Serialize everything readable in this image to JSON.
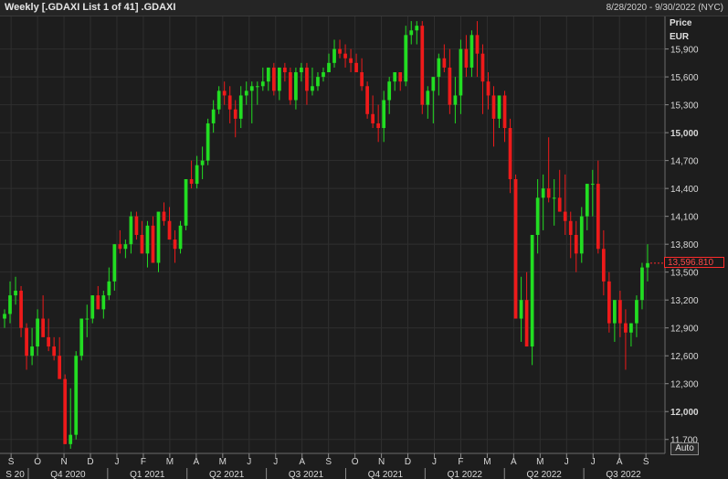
{
  "header": {
    "title": "Weekly [.GDAXI List 1 of 41] .GDAXI",
    "date_range": "8/28/2020 - 9/30/2022 (NYC)"
  },
  "axis": {
    "price_label": "Price",
    "currency_label": "EUR",
    "auto_label": "Auto"
  },
  "last_price_label": "13,596.810",
  "colors": {
    "up": "#22dd22",
    "down": "#ee1a1a",
    "background": "#1d1d1d",
    "grid": "#2f2f2f",
    "last_price": "#ff2a2a"
  },
  "chart_data": {
    "type": "candlestick",
    "title": "Weekly [.GDAXI List 1 of 41] .GDAXI",
    "ylabel": "Price EUR",
    "ylim": [
      11550,
      16250
    ],
    "y_ticks": [
      11700,
      12000,
      12300,
      12600,
      12900,
      13200,
      13500,
      13800,
      14100,
      14400,
      14700,
      15000,
      15300,
      15600,
      15900
    ],
    "y_tick_labels": [
      "11,700",
      "12,000",
      "12,300",
      "12,600",
      "12,900",
      "13,200",
      "13,500",
      "13,800",
      "14,100",
      "14,400",
      "14,700",
      "15,000",
      "15,300",
      "15,600",
      "15,900"
    ],
    "bold_ticks": [
      12000,
      15000
    ],
    "month_labels": [
      "S",
      "O",
      "N",
      "D",
      "J",
      "F",
      "M",
      "A",
      "M",
      "J",
      "J",
      "A",
      "S",
      "O",
      "N",
      "D",
      "J",
      "F",
      "M",
      "A",
      "M",
      "J",
      "J",
      "A",
      "S"
    ],
    "quarter_labels": [
      "S 20",
      "Q4 2020",
      "Q1 2021",
      "Q2 2021",
      "Q3 2021",
      "Q4 2021",
      "Q1 2022",
      "Q2 2022",
      "Q3 2022"
    ],
    "grid": true,
    "last_price": 13596.81,
    "ohlc": [
      [
        13000,
        13100,
        12900,
        13050
      ],
      [
        13050,
        13400,
        12950,
        13250
      ],
      [
        13250,
        13450,
        13150,
        13300
      ],
      [
        13300,
        13350,
        12800,
        12900
      ],
      [
        12900,
        12950,
        12450,
        12600
      ],
      [
        12600,
        12900,
        12500,
        12700
      ],
      [
        12700,
        13100,
        12600,
        13000
      ],
      [
        13000,
        13250,
        12850,
        12800
      ],
      [
        12800,
        13000,
        12650,
        12700
      ],
      [
        12700,
        12800,
        12550,
        12600
      ],
      [
        12600,
        12800,
        12400,
        12350
      ],
      [
        12350,
        12400,
        11650,
        11650
      ],
      [
        11650,
        12250,
        11600,
        11750
      ],
      [
        11750,
        12650,
        11700,
        12600
      ],
      [
        12600,
        13000,
        12550,
        13000
      ],
      [
        13000,
        13150,
        12800,
        13000
      ],
      [
        13000,
        13250,
        12950,
        13250
      ],
      [
        13250,
        13350,
        13100,
        13100
      ],
      [
        13100,
        13300,
        13000,
        13250
      ],
      [
        13250,
        13550,
        13200,
        13400
      ],
      [
        13400,
        13800,
        13300,
        13800
      ],
      [
        13800,
        13950,
        13700,
        13750
      ],
      [
        13750,
        13850,
        13650,
        13800
      ],
      [
        13800,
        14150,
        13700,
        14100
      ],
      [
        14100,
        14150,
        13850,
        13900
      ],
      [
        13900,
        14050,
        13700,
        13700
      ],
      [
        13700,
        14050,
        13550,
        14000
      ],
      [
        14000,
        14100,
        13850,
        13600
      ],
      [
        13600,
        14100,
        13500,
        14150
      ],
      [
        14150,
        14250,
        14000,
        14050
      ],
      [
        14050,
        14200,
        13900,
        13850
      ],
      [
        13850,
        13950,
        13600,
        13750
      ],
      [
        13750,
        14050,
        13700,
        14000
      ],
      [
        14000,
        14250,
        13950,
        14500
      ],
      [
        14500,
        14700,
        14400,
        14450
      ],
      [
        14450,
        14750,
        14400,
        14650
      ],
      [
        14650,
        14850,
        14500,
        14700
      ],
      [
        14700,
        15150,
        14650,
        15100
      ],
      [
        15100,
        15350,
        15000,
        15250
      ],
      [
        15250,
        15500,
        15200,
        15450
      ],
      [
        15450,
        15550,
        15300,
        15400
      ],
      [
        15400,
        15500,
        15100,
        15250
      ],
      [
        15250,
        15350,
        14950,
        15150
      ],
      [
        15150,
        15500,
        15050,
        15400
      ],
      [
        15400,
        15550,
        15300,
        15450
      ],
      [
        15450,
        15550,
        15100,
        15500
      ],
      [
        15500,
        15550,
        15300,
        15500
      ],
      [
        15500,
        15700,
        15450,
        15550
      ],
      [
        15550,
        15700,
        15450,
        15700
      ],
      [
        15700,
        15750,
        15400,
        15450
      ],
      [
        15450,
        15700,
        15350,
        15700
      ],
      [
        15700,
        15750,
        15550,
        15650
      ],
      [
        15650,
        15700,
        15300,
        15350
      ],
      [
        15350,
        15700,
        15250,
        15650
      ],
      [
        15650,
        15750,
        15550,
        15700
      ],
      [
        15700,
        15750,
        15300,
        15450
      ],
      [
        15450,
        15700,
        15400,
        15500
      ],
      [
        15500,
        15650,
        15450,
        15600
      ],
      [
        15600,
        15700,
        15550,
        15650
      ],
      [
        15650,
        15850,
        15650,
        15750
      ],
      [
        15750,
        16000,
        15700,
        15900
      ],
      [
        15900,
        16000,
        15800,
        15850
      ],
      [
        15850,
        15950,
        15700,
        15800
      ],
      [
        15800,
        15900,
        15650,
        15750
      ],
      [
        15750,
        15850,
        15650,
        15650
      ],
      [
        15650,
        15800,
        15450,
        15500
      ],
      [
        15500,
        15550,
        15150,
        15200
      ],
      [
        15200,
        15400,
        15050,
        15100
      ],
      [
        15100,
        15300,
        14900,
        15050
      ],
      [
        15050,
        15450,
        14900,
        15350
      ],
      [
        15350,
        15600,
        15200,
        15550
      ],
      [
        15550,
        15650,
        15450,
        15650
      ],
      [
        15650,
        15650,
        15450,
        15550
      ],
      [
        15550,
        16150,
        15500,
        16050
      ],
      [
        16050,
        16200,
        15950,
        16100
      ],
      [
        16100,
        16200,
        15950,
        16150
      ],
      [
        16150,
        16200,
        15200,
        15300
      ],
      [
        15300,
        15500,
        15150,
        15450
      ],
      [
        15450,
        15550,
        15100,
        15600
      ],
      [
        15600,
        15850,
        15400,
        15800
      ],
      [
        15800,
        15950,
        15650,
        15700
      ],
      [
        15700,
        15900,
        15200,
        15300
      ],
      [
        15300,
        15600,
        15100,
        15400
      ],
      [
        15400,
        16000,
        15200,
        15900
      ],
      [
        15900,
        16050,
        15600,
        15700
      ],
      [
        15700,
        16100,
        15600,
        16050
      ],
      [
        16050,
        16200,
        15600,
        15850
      ],
      [
        15850,
        15950,
        15200,
        15550
      ],
      [
        15550,
        15650,
        15250,
        15400
      ],
      [
        15400,
        15500,
        14850,
        15150
      ],
      [
        15150,
        15400,
        15050,
        15400
      ],
      [
        15400,
        15450,
        14900,
        15050
      ],
      [
        15050,
        15150,
        14350,
        14500
      ],
      [
        14500,
        14550,
        13600,
        13000
      ],
      [
        13000,
        13450,
        12750,
        13200
      ],
      [
        13200,
        13500,
        12700,
        12700
      ],
      [
        12700,
        13900,
        12500,
        13900
      ],
      [
        13900,
        14500,
        13700,
        14300
      ],
      [
        14300,
        14550,
        13950,
        14400
      ],
      [
        14400,
        14950,
        14250,
        14300
      ],
      [
        14300,
        14500,
        14000,
        14300
      ],
      [
        14300,
        14600,
        14150,
        14150
      ],
      [
        14150,
        14550,
        13900,
        14050
      ],
      [
        14050,
        14150,
        13650,
        13900
      ],
      [
        13900,
        14050,
        13500,
        13700
      ],
      [
        13700,
        14200,
        13600,
        14100
      ],
      [
        14100,
        14350,
        13950,
        14450
      ],
      [
        14450,
        14600,
        14100,
        14450
      ],
      [
        14450,
        14700,
        13700,
        13750
      ],
      [
        13750,
        13950,
        13250,
        13400
      ],
      [
        13400,
        13500,
        12850,
        12950
      ],
      [
        12950,
        13200,
        12750,
        13200
      ],
      [
        13200,
        13300,
        12800,
        12950
      ],
      [
        12950,
        13100,
        12450,
        12850
      ],
      [
        12850,
        12950,
        12700,
        12950
      ],
      [
        12950,
        13250,
        12800,
        13200
      ],
      [
        13200,
        13600,
        13100,
        13550
      ],
      [
        13550,
        13800,
        13400,
        13597
      ]
    ]
  }
}
